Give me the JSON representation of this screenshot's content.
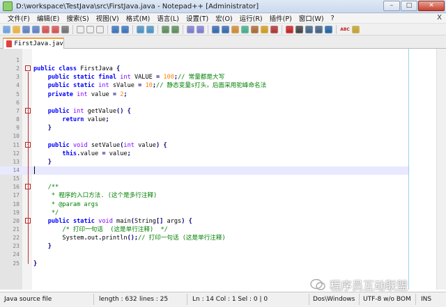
{
  "window": {
    "title": "D:\\workspace\\TestJava\\src\\FirstJava.java - Notepad++ [Administrator]",
    "controls": [
      "–",
      "□",
      "✕"
    ]
  },
  "menu": {
    "items": [
      "文件(F)",
      "编辑(E)",
      "搜索(S)",
      "视图(V)",
      "格式(M)",
      "语言(L)",
      "设置(T)",
      "宏(O)",
      "运行(R)",
      "插件(P)",
      "窗口(W)",
      "?"
    ],
    "close_glyph": "X"
  },
  "toolbar": {
    "icons": [
      "new-file-icon",
      "open-file-icon",
      "save-icon",
      "save-all-icon",
      "close-icon",
      "close-all-icon",
      "print-icon",
      "cut-icon",
      "copy-icon",
      "paste-icon",
      "undo-icon",
      "redo-icon",
      "find-icon",
      "replace-icon",
      "zoom-in-icon",
      "zoom-out-icon",
      "sync-vertical-icon",
      "sync-horizontal-icon",
      "word-wrap-icon",
      "show-all-chars-icon",
      "indent-guide-icon",
      "document-map-icon",
      "function-list-icon",
      "folder-workspace-icon",
      "monitoring-icon",
      "record-macro-icon",
      "stop-record-icon",
      "play-macro-icon",
      "run-macro-multiple-icon",
      "save-macro-icon",
      "spellcheck-icon",
      "plugin-icon"
    ],
    "spellcheck_label": "ABC"
  },
  "tab": {
    "label": "FirstJava.java"
  },
  "editor": {
    "current_line": 14,
    "lines": [
      {
        "n": "1",
        "tokens": []
      },
      {
        "n": "2",
        "fold": "-",
        "tokens": [
          [
            "kw",
            "public"
          ],
          [
            "t",
            " "
          ],
          [
            "kw",
            "class"
          ],
          [
            "t",
            " FirstJava "
          ],
          [
            "op",
            "{"
          ]
        ]
      },
      {
        "n": "3",
        "tokens": [
          [
            "t",
            "    "
          ],
          [
            "kw",
            "public"
          ],
          [
            "t",
            " "
          ],
          [
            "kw",
            "static"
          ],
          [
            "t",
            " "
          ],
          [
            "kw",
            "final"
          ],
          [
            "t",
            " "
          ],
          [
            "kt",
            "int"
          ],
          [
            "t",
            " VALUE "
          ],
          [
            "op",
            "="
          ],
          [
            "t",
            " "
          ],
          [
            "num",
            "100"
          ],
          [
            "op",
            ";"
          ],
          [
            "cm",
            "// 常量都是大写"
          ]
        ]
      },
      {
        "n": "4",
        "tokens": [
          [
            "t",
            "    "
          ],
          [
            "kw",
            "public"
          ],
          [
            "t",
            " "
          ],
          [
            "kw",
            "static"
          ],
          [
            "t",
            " "
          ],
          [
            "kt",
            "int"
          ],
          [
            "t",
            " sValue "
          ],
          [
            "op",
            "="
          ],
          [
            "t",
            " "
          ],
          [
            "num",
            "10"
          ],
          [
            "op",
            ";"
          ],
          [
            "cm",
            "// 静态变量s打头，后面采用驼峰命名法"
          ]
        ]
      },
      {
        "n": "5",
        "tokens": [
          [
            "t",
            "    "
          ],
          [
            "kw",
            "private"
          ],
          [
            "t",
            " "
          ],
          [
            "kt",
            "int"
          ],
          [
            "t",
            " value "
          ],
          [
            "op",
            "="
          ],
          [
            "t",
            " "
          ],
          [
            "num",
            "2"
          ],
          [
            "op",
            ";"
          ]
        ]
      },
      {
        "n": "6",
        "tokens": []
      },
      {
        "n": "7",
        "fold": "-",
        "tokens": [
          [
            "t",
            "    "
          ],
          [
            "kw",
            "public"
          ],
          [
            "t",
            " "
          ],
          [
            "kt",
            "int"
          ],
          [
            "t",
            " getValue"
          ],
          [
            "op",
            "()"
          ],
          [
            "t",
            " "
          ],
          [
            "op",
            "{"
          ]
        ]
      },
      {
        "n": "8",
        "tokens": [
          [
            "t",
            "        "
          ],
          [
            "kw",
            "return"
          ],
          [
            "t",
            " value"
          ],
          [
            "op",
            ";"
          ]
        ]
      },
      {
        "n": "9",
        "tokens": [
          [
            "t",
            "    "
          ],
          [
            "op",
            "}"
          ]
        ]
      },
      {
        "n": "10",
        "tokens": []
      },
      {
        "n": "11",
        "fold": "-",
        "tokens": [
          [
            "t",
            "    "
          ],
          [
            "kw",
            "public"
          ],
          [
            "t",
            " "
          ],
          [
            "kt",
            "void"
          ],
          [
            "t",
            " setValue"
          ],
          [
            "op",
            "("
          ],
          [
            "kt",
            "int"
          ],
          [
            "t",
            " value"
          ],
          [
            "op",
            ")"
          ],
          [
            "t",
            " "
          ],
          [
            "op",
            "{"
          ]
        ]
      },
      {
        "n": "12",
        "tokens": [
          [
            "t",
            "        "
          ],
          [
            "kw",
            "this"
          ],
          [
            "op",
            "."
          ],
          [
            "t",
            "value "
          ],
          [
            "op",
            "="
          ],
          [
            "t",
            " value"
          ],
          [
            "op",
            ";"
          ]
        ]
      },
      {
        "n": "13",
        "tokens": [
          [
            "t",
            "    "
          ],
          [
            "op",
            "}"
          ]
        ]
      },
      {
        "n": "14",
        "tokens": []
      },
      {
        "n": "15",
        "tokens": []
      },
      {
        "n": "16",
        "fold": "-",
        "tokens": [
          [
            "cm",
            "    /**"
          ]
        ]
      },
      {
        "n": "17",
        "tokens": [
          [
            "cm",
            "     * 程序的入口方法. (这个是多行注释)"
          ]
        ]
      },
      {
        "n": "18",
        "tokens": [
          [
            "cm",
            "     * @param args"
          ]
        ]
      },
      {
        "n": "19",
        "tokens": [
          [
            "cm",
            "     */"
          ]
        ]
      },
      {
        "n": "20",
        "fold": "-",
        "tokens": [
          [
            "t",
            "    "
          ],
          [
            "kw",
            "public"
          ],
          [
            "t",
            " "
          ],
          [
            "kw",
            "static"
          ],
          [
            "t",
            " "
          ],
          [
            "kt",
            "void"
          ],
          [
            "t",
            " main"
          ],
          [
            "op",
            "("
          ],
          [
            "t",
            "String"
          ],
          [
            "op",
            "[]"
          ],
          [
            "t",
            " args"
          ],
          [
            "op",
            ")"
          ],
          [
            "t",
            " "
          ],
          [
            "op",
            "{"
          ]
        ]
      },
      {
        "n": "21",
        "tokens": [
          [
            "t",
            "        "
          ],
          [
            "cm",
            "/* 打印一句话  (这是单行注释)  */"
          ]
        ]
      },
      {
        "n": "22",
        "tokens": [
          [
            "t",
            "        System"
          ],
          [
            "op",
            "."
          ],
          [
            "t",
            "out"
          ],
          [
            "op",
            "."
          ],
          [
            "t",
            "println"
          ],
          [
            "op",
            "();"
          ],
          [
            "cm",
            "// 打印一句话 (这是单行注释)"
          ]
        ]
      },
      {
        "n": "23",
        "tokens": [
          [
            "t",
            "    "
          ],
          [
            "op",
            "}"
          ]
        ]
      },
      {
        "n": "24",
        "tokens": []
      },
      {
        "n": "25",
        "tokens": [
          [
            "op",
            "}"
          ]
        ]
      }
    ]
  },
  "status": {
    "file_type": "Java source file",
    "length": "length : 632",
    "lines": "lines : 25",
    "position": "Ln : 14    Col : 1    Sel : 0 | 0",
    "eol": "Dos\\Windows",
    "encoding": "UTF-8 w/o BOM",
    "mode": "INS"
  },
  "watermark": {
    "text": "程序员互动联盟"
  },
  "colors": {
    "keyword": "#0000ff",
    "type": "#8000ff",
    "number": "#ff8000",
    "comment": "#008000",
    "operator": "#000080",
    "tab_accent": "#f2a03a",
    "fold_marker": "#b42020",
    "current_line": "#e8e8ff"
  }
}
